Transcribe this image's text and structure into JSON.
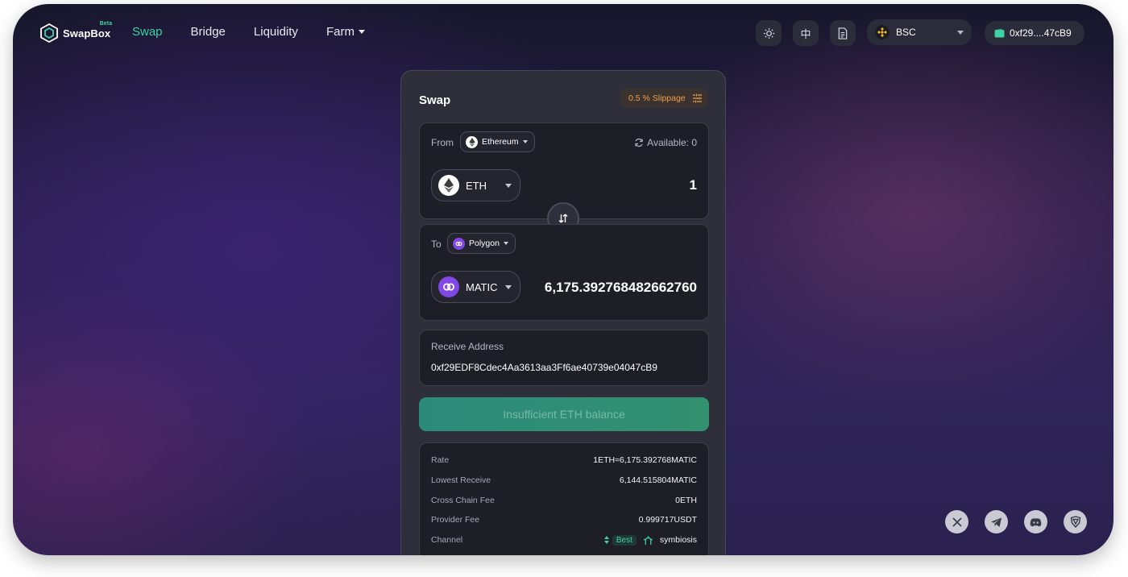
{
  "header": {
    "logo_text": "SwapBox",
    "logo_badge": "Beta",
    "nav": [
      {
        "label": "Swap",
        "active": true
      },
      {
        "label": "Bridge",
        "active": false
      },
      {
        "label": "Liquidity",
        "active": false
      },
      {
        "label": "Farm",
        "active": false,
        "has_dropdown": true
      }
    ],
    "theme_icon": "sun-icon",
    "lang_label": "中",
    "docs_icon": "document-icon",
    "network": {
      "label": "BSC",
      "icon": "bnb-icon"
    },
    "wallet": {
      "label": "0xf29....47cB9",
      "icon": "wallet-icon"
    }
  },
  "swap": {
    "title": "Swap",
    "slippage_label": "0.5 % Slippage",
    "from": {
      "label": "From",
      "chain": "Ethereum",
      "available": "Available: 0",
      "token": "ETH",
      "amount": "1"
    },
    "to": {
      "label": "To",
      "chain": "Polygon",
      "token": "MATIC",
      "amount": "6,175.392768482662760"
    },
    "receive": {
      "label": "Receive Address",
      "address": "0xf29EDF8Cdec4Aa3613aa3Ff6ae40739e04047cB9"
    },
    "cta_label": "Insufficient ETH balance",
    "info": {
      "rate_k": "Rate",
      "rate_v": "1ETH≈6,175.392768MATIC",
      "lowest_k": "Lowest Receive",
      "lowest_v": "6,144.515804MATIC",
      "ccfee_k": "Cross Chain Fee",
      "ccfee_v": "0ETH",
      "pfee_k": "Provider Fee",
      "pfee_v": "0.999717USDT",
      "channel_k": "Channel",
      "channel_badge": "Best",
      "channel_v": "symbiosis"
    }
  },
  "social": [
    "x-icon",
    "telegram-icon",
    "discord-icon",
    "shield-icon"
  ],
  "colors": {
    "accent": "#3fd1a4",
    "slippage": "#f0a04b",
    "card": "#2e2f3b"
  }
}
